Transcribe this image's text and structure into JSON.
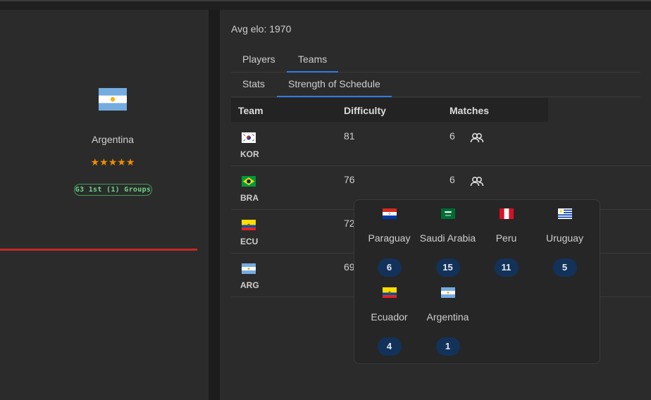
{
  "team": {
    "name": "Argentina",
    "rating_stars": "★★★★★",
    "group_badge": "G3 1st (1) Groups"
  },
  "summary": {
    "avg_elo": "Avg elo: 1970"
  },
  "tabs_primary": [
    {
      "label": "Players",
      "active": false
    },
    {
      "label": "Teams",
      "active": true
    }
  ],
  "tabs_secondary": [
    {
      "label": "Stats",
      "active": false
    },
    {
      "label": "Strength of Schedule",
      "active": true
    }
  ],
  "table": {
    "headers": [
      "Team",
      "Difficulty",
      "Matches"
    ],
    "rows": [
      {
        "code": "KOR",
        "difficulty": "81",
        "matches": "6",
        "flag": "south-korea-flag"
      },
      {
        "code": "BRA",
        "difficulty": "76",
        "matches": "6",
        "flag": "brazil-flag"
      },
      {
        "code": "ECU",
        "difficulty": "72",
        "matches": "",
        "flag": "ecuador-flag"
      },
      {
        "code": "ARG",
        "difficulty": "69",
        "matches": "",
        "flag": "argentina-flag"
      }
    ]
  },
  "popover": {
    "opponents": [
      {
        "name": "Paraguay",
        "count": "6",
        "flag": "paraguay-flag"
      },
      {
        "name": "Saudi Arabia",
        "count": "15",
        "flag": "saudi-arabia-flag"
      },
      {
        "name": "Peru",
        "count": "11",
        "flag": "peru-flag"
      },
      {
        "name": "Uruguay",
        "count": "5",
        "flag": "uruguay-flag"
      },
      {
        "name": "Ecuador",
        "count": "4",
        "flag": "ecuador-flag"
      },
      {
        "name": "Argentina",
        "count": "1",
        "flag": "argentina-flag"
      }
    ]
  },
  "colors": {
    "accent_tab": "#2f7de1",
    "star": "#f08c00",
    "badge_green": "#6fd38a",
    "red_line": "#c62828",
    "count_pill": "#13325a"
  }
}
